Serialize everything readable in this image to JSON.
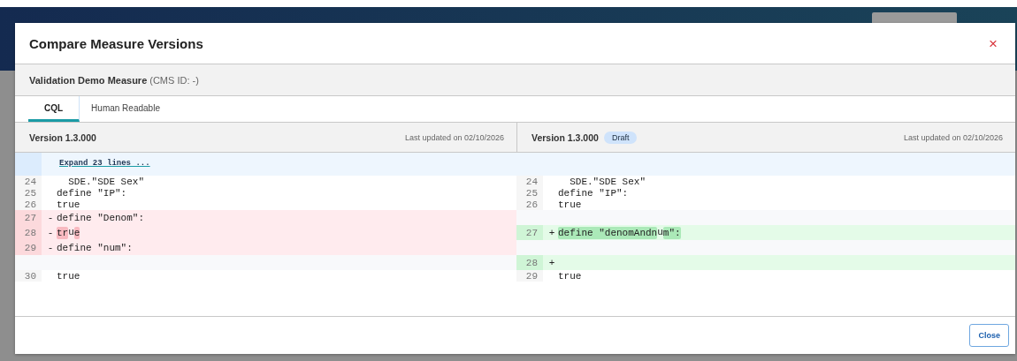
{
  "dialog": {
    "title": "Compare Measure Versions",
    "close_icon": "×"
  },
  "measure": {
    "name": "Validation Demo Measure",
    "cms_id": "(CMS ID: -)"
  },
  "tabs": [
    {
      "label": "CQL",
      "selected": true
    },
    {
      "label": "Human Readable",
      "selected": false
    }
  ],
  "versions": [
    {
      "version": "Version 1.3.000",
      "updated": "Last updated on 02/10/2026"
    },
    {
      "version": "Version 1.3.000",
      "badge": "Draft",
      "updated": "Last updated on 02/10/2026"
    }
  ],
  "expand_link": "Expand 23 lines ...",
  "rows": [
    {
      "left": {
        "kind": "context",
        "num": "24",
        "segments": [
          {
            "text": "  SDE.\"SDE Sex\"",
            "changed": false
          }
        ]
      },
      "right": {
        "kind": "context",
        "num": "24",
        "segments": [
          {
            "text": "  SDE.\"SDE Sex\"",
            "changed": false
          }
        ]
      }
    },
    {
      "left": {
        "kind": "context",
        "num": "25",
        "segments": [
          {
            "text": "define \"IP\":",
            "changed": false
          }
        ]
      },
      "right": {
        "kind": "context",
        "num": "25",
        "segments": [
          {
            "text": "define \"IP\":",
            "changed": false
          }
        ]
      }
    },
    {
      "left": {
        "kind": "context",
        "num": "26",
        "segments": [
          {
            "text": "true",
            "changed": false
          }
        ]
      },
      "right": {
        "kind": "context",
        "num": "26",
        "segments": [
          {
            "text": "true",
            "changed": false
          }
        ]
      }
    },
    {
      "left": {
        "kind": "removed",
        "num": "27",
        "sign": "-",
        "segments": [
          {
            "text": "define \"Denom\":",
            "changed": false
          }
        ]
      },
      "right": {
        "kind": "blank"
      }
    },
    {
      "left": {
        "kind": "removed",
        "num": "28",
        "sign": "-",
        "segments": [
          {
            "text": "tr",
            "changed": true
          },
          {
            "text": "u",
            "changed": false
          },
          {
            "text": "e",
            "changed": true
          }
        ]
      },
      "right": {
        "kind": "added",
        "num": "27",
        "sign": "+",
        "segments": [
          {
            "text": "define \"denomAndn",
            "changed": true
          },
          {
            "text": "u",
            "changed": false
          },
          {
            "text": "m\":",
            "changed": true
          }
        ]
      }
    },
    {
      "left": {
        "kind": "removed",
        "num": "29",
        "sign": "-",
        "segments": [
          {
            "text": "define \"num\":",
            "changed": false
          }
        ]
      },
      "right": {
        "kind": "blank"
      }
    },
    {
      "left": {
        "kind": "blank"
      },
      "right": {
        "kind": "added",
        "num": "28",
        "sign": "+"
      }
    },
    {
      "left": {
        "kind": "context",
        "num": "30",
        "segments": [
          {
            "text": "true",
            "changed": false
          }
        ]
      },
      "right": {
        "kind": "context",
        "num": "29",
        "segments": [
          {
            "text": "true",
            "changed": false
          }
        ]
      }
    }
  ],
  "footer": {
    "close_button": "Close"
  }
}
